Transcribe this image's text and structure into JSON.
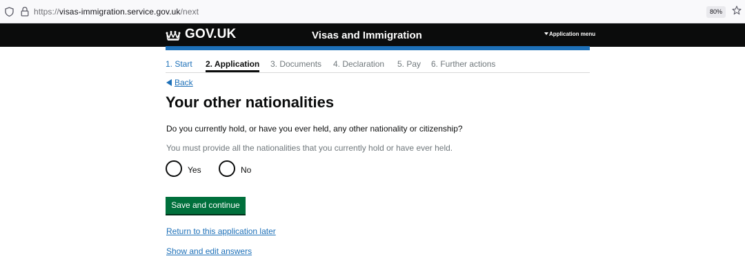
{
  "browser": {
    "url_scheme": "https://",
    "url_host": "visas-immigration.service.gov.uk",
    "url_path": "/next",
    "zoom": "80%"
  },
  "header": {
    "logo": "GOV.UK",
    "service_name": "Visas and Immigration",
    "menu_label": "Application menu"
  },
  "steps": [
    {
      "label": "1. Start",
      "state": "done"
    },
    {
      "label": "2. Application",
      "state": "current"
    },
    {
      "label": "3. Documents",
      "state": "pending"
    },
    {
      "label": "4. Declaration",
      "state": "pending"
    },
    {
      "label": "5. Pay",
      "state": "pending"
    },
    {
      "label": "6. Further actions",
      "state": "pending"
    }
  ],
  "back_label": "Back",
  "page_title": "Your other nationalities",
  "question": "Do you currently hold, or have you ever held, any other nationality or citizenship?",
  "hint": "You must provide all the nationalities that you currently hold or have ever held.",
  "options": {
    "yes": "Yes",
    "no": "No"
  },
  "submit_label": "Save and continue",
  "links": {
    "return_later": "Return to this application later",
    "show_edit": "Show and edit answers"
  },
  "colors": {
    "header_bg": "#0b0c0c",
    "accent_blue": "#1d70b8",
    "button_green": "#00703c",
    "hint_grey": "#6f777b"
  },
  "icons": [
    "shield-icon",
    "lock-icon",
    "star-icon",
    "crown-icon",
    "caret-down-icon",
    "back-arrow-icon"
  ]
}
